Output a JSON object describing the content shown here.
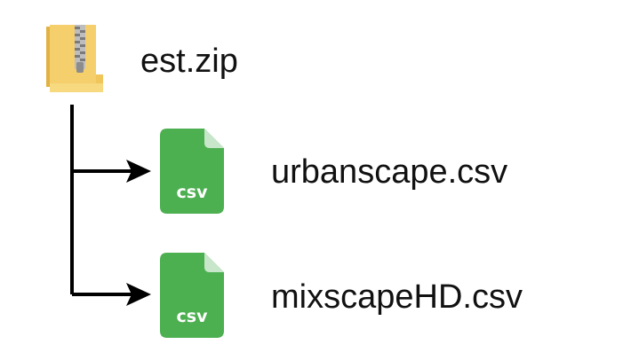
{
  "tree": {
    "root": {
      "name": "est.zip",
      "icon": "zip-folder-icon"
    },
    "children": [
      {
        "name": "urbanscape.csv",
        "icon": "csv-file-icon",
        "badge": "csv"
      },
      {
        "name": "mixscapeHD.csv",
        "icon": "csv-file-icon",
        "badge": "csv"
      }
    ]
  },
  "colors": {
    "folder": "#F5CF6B",
    "folder_dark": "#E2B143",
    "zipper": "#9A9A9A",
    "csv_green": "#4CAF50",
    "csv_fold": "#C8E6C9",
    "connector": "#000000"
  }
}
